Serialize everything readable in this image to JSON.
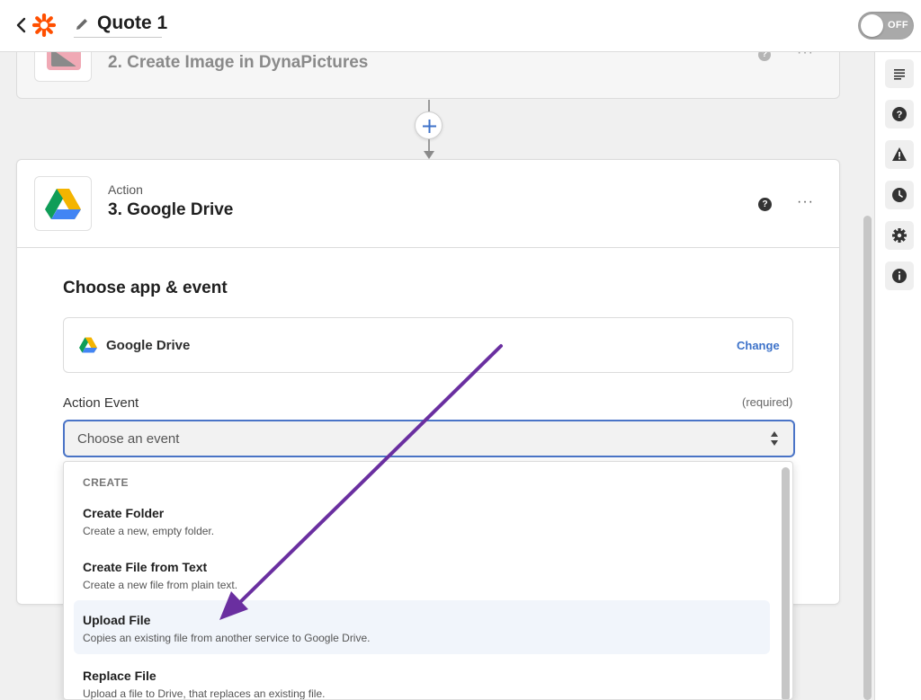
{
  "header": {
    "zap_title": "Quote 1",
    "toggle_label": "OFF"
  },
  "steps": {
    "step2": {
      "title": "2. Create Image in DynaPictures"
    },
    "step3": {
      "type_label": "Action",
      "title": "3. Google Drive",
      "section_title": "Choose app & event",
      "app_name": "Google Drive",
      "change_label": "Change",
      "action_event_label": "Action Event",
      "required_label": "(required)",
      "select_placeholder": "Choose an event"
    }
  },
  "dropdown": {
    "heading": "CREATE",
    "items": [
      {
        "title": "Create Folder",
        "desc": "Create a new, empty folder."
      },
      {
        "title": "Create File from Text",
        "desc": "Create a new file from plain text."
      },
      {
        "title": "Upload File",
        "desc": "Copies an existing file from another service to Google Drive."
      },
      {
        "title": "Replace File",
        "desc": "Upload a file to Drive, that replaces an existing file."
      }
    ]
  },
  "sidebar": {
    "items": [
      "outline-icon",
      "help-icon",
      "warning-icon",
      "history-icon",
      "settings-icon",
      "info-icon"
    ]
  },
  "colors": {
    "accent": "#4a74c7",
    "link": "#3d72c9",
    "annotation": "#6a2fa0",
    "brand_orange": "#ff4f00"
  }
}
